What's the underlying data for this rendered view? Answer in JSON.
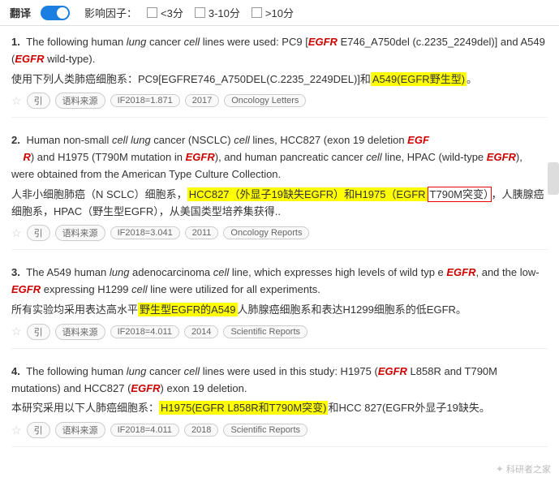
{
  "topbar": {
    "translate_label": "翻译",
    "factor_label": "影响因子：",
    "checkbox1_label": "<3分",
    "checkbox2_label": "3-10分",
    "checkbox3_label": ">10分"
  },
  "results": [
    {
      "number": "1.",
      "en_text": "The following human lung cancer cell lines were used: PC9 [EGFR E746_A750del (c.2235_2249del)] and A549 (EGFR wild-type).",
      "zh_text": "使用下列人类肺癌细胞系：PC9[EGFRE746_A750DEL(C.2235_2249DEL)]和A549(EGFR野生型)。",
      "if_value": "IF2018=1.871",
      "year": "2017",
      "journal": "Oncology Letters",
      "zh_highlight": "A549(EGFR野生型)"
    },
    {
      "number": "2.",
      "en_text": "Human non-small cell lung cancer (NSCLC) cell lines, HCC827 (exon 19 deletion EGFR) and H1975 (T790M mutation in EGFR), and human pancreatic cancer cell line, HPAC (wild-type EGFR), were obtained from the American Type Culture Collection.",
      "zh_text": "人非小细胞肺癌（N SCLC）细胞系，HCC827（外显子19缺失EGFR）和H1975（EGFR T790M突变），人胰腺癌细胞系，HPAC（野生型EGFR），从美国类型培养集获得..",
      "if_value": "IF2018=3.041",
      "year": "2011",
      "journal": "Oncology Reports",
      "zh_highlight1": "HCC827（外显子19缺失EGFR）和H1975（EGFR",
      "zh_highlight2": "T790M突变）"
    },
    {
      "number": "3.",
      "en_text": "The A549 human lung adenocarcinoma cell line, which expresses high levels of wild type EGFR, and the low-EGFR expressing H1299 cell line were utilized for all experiments.",
      "zh_text": "所有实验均采用表达高水平野生型EGFR的A549人肺腺癌细胞系和表达H1299细胞系的低EGFR。",
      "if_value": "IF2018=4.011",
      "year": "2014",
      "journal": "Scientific Reports",
      "zh_highlight": "野生型EGFR的A549"
    },
    {
      "number": "4.",
      "en_text": "The following human lung cancer cell lines were used in this study: H1975 (EGFR L858R and T790M mutations) and HCC827 (EGFR exon 19 deletion.",
      "zh_text": "本研究采用以下人肺癌细胞系：H1975(EGFR L858R和T790M突变)和HCC 827(EGFR外显子19缺失。",
      "if_value": "IF2018=4.011",
      "year": "2018",
      "journal": "Scientific Reports",
      "zh_highlight": "H1975(EGFR L858R和T790M突变)"
    }
  ],
  "watermark": "科研者之家"
}
